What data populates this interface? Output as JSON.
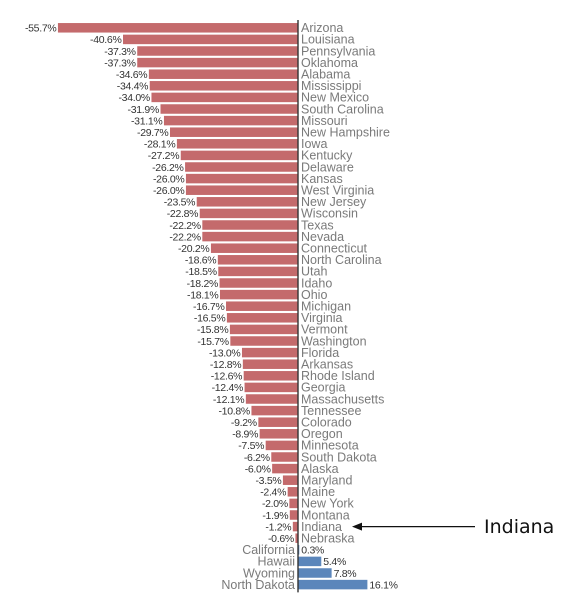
{
  "chart_data": {
    "type": "bar",
    "orientation": "horizontal",
    "title": "",
    "xlabel": "",
    "ylabel": "",
    "value_suffix": "%",
    "xlim": [
      -55.7,
      16.1
    ],
    "grid": false,
    "legend": "none",
    "colors": {
      "negative": "#c46a6c",
      "positive": "#5b86bb",
      "axis": "#333333"
    },
    "categories": [
      "Arizona",
      "Louisiana",
      "Pennsylvania",
      "Oklahoma",
      "Alabama",
      "Mississippi",
      "New Mexico",
      "South Carolina",
      "Missouri",
      "New Hampshire",
      "Iowa",
      "Kentucky",
      "Delaware",
      "Kansas",
      "West Virginia",
      "New Jersey",
      "Wisconsin",
      "Texas",
      "Nevada",
      "Connecticut",
      "North Carolina",
      "Utah",
      "Idaho",
      "Ohio",
      "Michigan",
      "Virginia",
      "Vermont",
      "Washington",
      "Florida",
      "Arkansas",
      "Rhode Island",
      "Georgia",
      "Massachusetts",
      "Tennessee",
      "Colorado",
      "Oregon",
      "Minnesota",
      "South Dakota",
      "Alaska",
      "Maryland",
      "Maine",
      "New York",
      "Montana",
      "Indiana",
      "Nebraska",
      "California",
      "Hawaii",
      "Wyoming",
      "North Dakota"
    ],
    "values": [
      -55.7,
      -40.6,
      -37.3,
      -37.3,
      -34.6,
      -34.4,
      -34.0,
      -31.9,
      -31.1,
      -29.7,
      -28.1,
      -27.2,
      -26.2,
      -26.0,
      -26.0,
      -23.5,
      -22.8,
      -22.2,
      -22.2,
      -20.2,
      -18.6,
      -18.5,
      -18.2,
      -18.1,
      -16.7,
      -16.5,
      -15.8,
      -15.7,
      -13.0,
      -12.8,
      -12.6,
      -12.4,
      -12.1,
      -10.8,
      -9.2,
      -8.9,
      -7.5,
      -6.2,
      -6.0,
      -3.5,
      -2.4,
      -2.0,
      -1.9,
      -1.2,
      -0.6,
      0.3,
      5.4,
      7.8,
      16.1
    ],
    "annotations": [
      {
        "text": "Indiana",
        "target": "Indiana",
        "type": "arrow"
      }
    ]
  }
}
